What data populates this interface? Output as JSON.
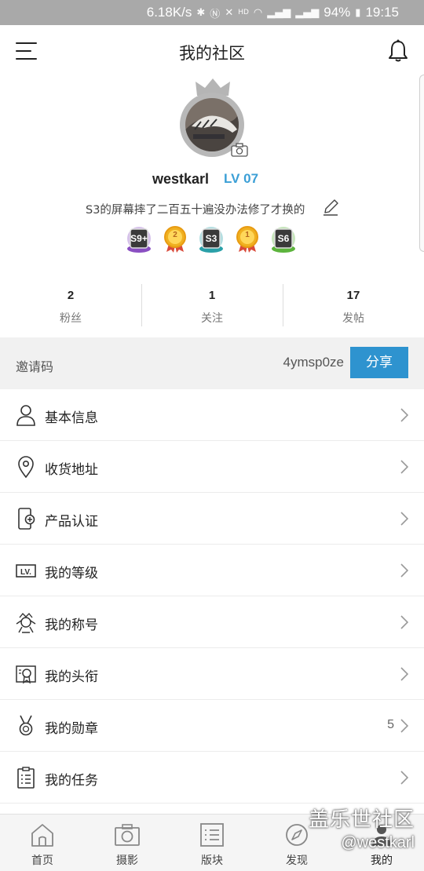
{
  "status_bar": {
    "speed": "6.18K/s",
    "battery": "94%",
    "time": "19:15",
    "icons": [
      "bluetooth-icon",
      "nfc-icon",
      "mute-icon",
      "hd-voice-icon",
      "wifi-icon",
      "4g-signal-icon",
      "4g-signal-icon",
      "battery-charging-icon"
    ]
  },
  "header": {
    "title": "我的社区",
    "menu_icon": "hamburger-menu-icon",
    "notification_icon": "bell-icon"
  },
  "profile": {
    "username": "westkarl",
    "level": "LV 07",
    "signature": "S3的屏幕摔了二百五十遍没办法修了才换的",
    "badges": [
      {
        "text": "S9+",
        "color": "#8a4fc2",
        "icon": "s9-plus-badge-icon"
      },
      {
        "text": "2",
        "color": "#f0b020",
        "icon": "medal-2-badge-icon"
      },
      {
        "text": "S3",
        "color": "#2aa0a8",
        "icon": "s3-badge-icon"
      },
      {
        "text": "1",
        "color": "#f0b020",
        "icon": "medal-1-badge-icon"
      },
      {
        "text": "S6",
        "color": "#5cb43c",
        "icon": "s6-badge-icon"
      }
    ]
  },
  "stats": [
    {
      "value": "2",
      "label": "粉丝"
    },
    {
      "value": "1",
      "label": "关注"
    },
    {
      "value": "17",
      "label": "发帖"
    }
  ],
  "invite": {
    "label": "邀请码",
    "code": "4ymsp0ze",
    "share_label": "分享"
  },
  "menu": [
    {
      "label": "基本信息",
      "icon": "person-icon",
      "count": ""
    },
    {
      "label": "收货地址",
      "icon": "location-pin-icon",
      "count": ""
    },
    {
      "label": "产品认证",
      "icon": "phone-certify-icon",
      "count": ""
    },
    {
      "label": "我的等级",
      "icon": "level-lv-icon",
      "count": ""
    },
    {
      "label": "我的称号",
      "icon": "title-crown-icon",
      "count": ""
    },
    {
      "label": "我的头衔",
      "icon": "certificate-icon",
      "count": ""
    },
    {
      "label": "我的勋章",
      "icon": "medal-icon",
      "count": "5"
    },
    {
      "label": "我的任务",
      "icon": "clipboard-icon",
      "count": ""
    }
  ],
  "bottom_nav": [
    {
      "label": "首页",
      "icon": "home-icon"
    },
    {
      "label": "摄影",
      "icon": "camera-icon"
    },
    {
      "label": "版块",
      "icon": "boards-list-icon"
    },
    {
      "label": "发现",
      "icon": "compass-icon"
    },
    {
      "label": "我的",
      "icon": "user-icon",
      "active": true
    }
  ],
  "watermark": {
    "line1": "盖乐世社区",
    "line2": "@westkarl"
  },
  "colors": {
    "accent": "#2e93cf",
    "level": "#3b9fd6",
    "statusbar": "#a9a9a9",
    "invite_bg": "#f1f1f1"
  }
}
